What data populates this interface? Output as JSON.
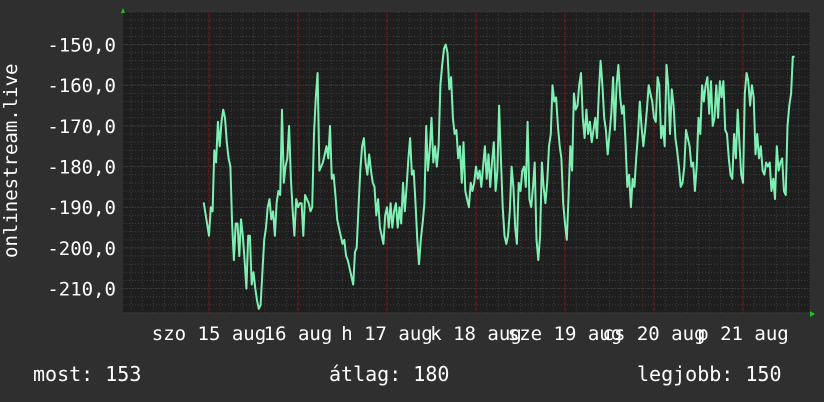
{
  "chart_data": {
    "type": "line",
    "ylabel": "onlinestream.live",
    "y_ticks": [
      "-150,0",
      "-160,0",
      "-170,0",
      "-180,0",
      "-190,0",
      "-200,0",
      "-210,0"
    ],
    "x_tick_labels": [
      "szo 15 aug",
      "16 aug",
      "h 17 aug",
      "k 18 aug",
      "sze 19 aug",
      "cs 20 aug",
      "p 21 aug"
    ],
    "ylim": [
      -216,
      -142
    ],
    "x_range_days": [
      0,
      7
    ],
    "grid": true,
    "series": [
      {
        "color": "#7ef0b4",
        "x_days": [
          -0.06,
          0.0,
          0.02,
          0.04,
          0.06,
          0.08,
          0.1,
          0.12,
          0.14,
          0.16,
          0.18,
          0.2,
          0.22,
          0.24,
          0.26,
          0.28,
          0.3,
          0.32,
          0.34,
          0.36,
          0.38,
          0.4,
          0.42,
          0.44,
          0.46,
          0.48,
          0.5,
          0.52,
          0.54,
          0.56,
          0.58,
          0.6,
          0.62,
          0.64,
          0.66,
          0.68,
          0.7,
          0.72,
          0.74,
          0.76,
          0.78,
          0.8,
          0.82,
          0.84,
          0.86,
          0.88,
          0.9,
          0.92,
          0.94,
          0.96,
          0.98,
          1.0,
          1.02,
          1.04,
          1.06,
          1.08,
          1.1,
          1.12,
          1.14,
          1.16,
          1.18,
          1.2,
          1.22,
          1.24,
          1.26,
          1.28,
          1.3,
          1.32,
          1.34,
          1.36,
          1.38,
          1.4,
          1.42,
          1.44,
          1.46,
          1.48,
          1.5,
          1.52,
          1.54,
          1.56,
          1.58,
          1.6,
          1.62,
          1.64,
          1.66,
          1.68,
          1.7,
          1.72,
          1.74,
          1.76,
          1.78,
          1.8,
          1.82,
          1.84,
          1.86,
          1.88,
          1.9,
          1.92,
          1.94,
          1.96,
          1.98,
          2.0,
          2.02,
          2.04,
          2.06,
          2.08,
          2.1,
          2.12,
          2.14,
          2.16,
          2.18,
          2.2,
          2.22,
          2.24,
          2.26,
          2.28,
          2.3,
          2.32,
          2.34,
          2.36,
          2.38,
          2.4,
          2.42,
          2.44,
          2.46,
          2.48,
          2.5,
          2.52,
          2.54,
          2.56,
          2.58,
          2.6,
          2.62,
          2.64,
          2.66,
          2.68,
          2.7,
          2.72,
          2.74,
          2.76,
          2.78,
          2.8,
          2.82,
          2.84,
          2.86,
          2.88,
          2.9,
          2.92,
          2.94,
          2.96,
          2.98,
          3.0,
          3.02,
          3.04,
          3.06,
          3.08,
          3.1,
          3.12,
          3.14,
          3.16,
          3.18,
          3.2,
          3.22,
          3.24,
          3.26,
          3.28,
          3.3,
          3.32,
          3.34,
          3.36,
          3.38,
          3.4,
          3.42,
          3.44,
          3.46,
          3.48,
          3.5,
          3.52,
          3.54,
          3.56,
          3.58,
          3.6,
          3.62,
          3.64,
          3.66,
          3.68,
          3.7,
          3.72,
          3.74,
          3.76,
          3.78,
          3.8,
          3.82,
          3.84,
          3.86,
          3.88,
          3.9,
          3.92,
          3.94,
          3.96,
          3.98,
          4.0,
          4.02,
          4.04,
          4.06,
          4.08,
          4.1,
          4.12,
          4.14,
          4.16,
          4.18,
          4.2,
          4.22,
          4.24,
          4.26,
          4.28,
          4.3,
          4.32,
          4.34,
          4.36,
          4.38,
          4.4,
          4.42,
          4.44,
          4.46,
          4.48,
          4.5,
          4.52,
          4.54,
          4.56,
          4.58,
          4.6,
          4.62,
          4.64,
          4.66,
          4.68,
          4.7,
          4.72,
          4.74,
          4.76,
          4.78,
          4.8,
          4.82,
          4.84,
          4.86,
          4.88,
          4.9,
          4.92,
          4.94,
          4.96,
          4.98,
          5.0,
          5.02,
          5.04,
          5.06,
          5.08,
          5.1,
          5.12,
          5.14,
          5.16,
          5.18,
          5.2,
          5.22,
          5.24,
          5.26,
          5.28,
          5.3,
          5.32,
          5.34,
          5.36,
          5.38,
          5.4,
          5.42,
          5.44,
          5.46,
          5.48,
          5.5,
          5.52,
          5.54,
          5.56,
          5.58,
          5.6,
          5.62,
          5.64,
          5.66,
          5.68,
          5.7,
          5.72,
          5.74,
          5.76,
          5.78,
          5.8,
          5.82,
          5.84,
          5.86,
          5.88,
          5.9,
          5.92,
          5.94,
          5.96,
          5.98,
          6.0,
          6.02,
          6.04,
          6.06,
          6.08,
          6.1,
          6.12,
          6.14,
          6.16,
          6.18,
          6.2,
          6.22,
          6.24,
          6.26,
          6.28,
          6.3,
          6.32,
          6.34,
          6.36,
          6.38,
          6.4,
          6.42,
          6.44,
          6.46,
          6.48,
          6.5,
          6.52,
          6.54,
          6.56,
          6.58,
          6.6,
          6.62,
          6.64,
          6.66,
          6.68,
          6.7,
          6.72,
          6.74,
          6.76,
          6.78,
          6.8,
          6.82,
          6.84,
          6.86,
          6.88,
          6.9,
          6.92,
          6.94,
          6.96,
          6.98,
          7.0,
          7.02,
          7.04,
          7.06,
          7.08,
          7.1,
          7.12,
          7.14,
          7.16,
          7.18,
          7.2,
          7.22,
          7.24,
          7.26,
          7.28,
          7.3,
          7.32,
          7.34,
          7.36,
          7.38,
          7.4,
          7.42
        ],
        "values": [
          -188.8,
          -197.0,
          -190.0,
          -191.0,
          -176.0,
          -179.0,
          -169.0,
          -175.0,
          -169.0,
          -166.0,
          -168.0,
          -174.0,
          -178.0,
          -180.0,
          -194.0,
          -203.0,
          -194.0,
          -194.0,
          -202.0,
          -193.0,
          -197.0,
          -203.0,
          -210.0,
          -197.0,
          -197.0,
          -209.0,
          -206.0,
          -210.0,
          -213.0,
          -215.0,
          -214.0,
          -206.0,
          -198.0,
          -195.0,
          -190.0,
          -188.0,
          -193.0,
          -191.0,
          -197.0,
          -189.0,
          -186.0,
          -187.0,
          -166.0,
          -184.0,
          -180.0,
          -178.0,
          -170.0,
          -183.0,
          -191.0,
          -197.0,
          -188.0,
          -190.0,
          -189.0,
          -189.0,
          -197.0,
          -187.0,
          -188.0,
          -189.0,
          -191.0,
          -190.0,
          -172.0,
          -163.0,
          -157.0,
          -181.0,
          -180.0,
          -179.0,
          -177.0,
          -175.0,
          -178.0,
          -170.0,
          -183.0,
          -182.0,
          -187.0,
          -193.0,
          -195.0,
          -197.0,
          -199.0,
          -198.0,
          -202.0,
          -203.0,
          -205.0,
          -207.0,
          -209.0,
          -201.0,
          -200.0,
          -190.0,
          -181.0,
          -175.0,
          -173.0,
          -179.0,
          -182.0,
          -177.0,
          -181.0,
          -184.0,
          -185.0,
          -192.0,
          -188.0,
          -195.0,
          -197.0,
          -199.0,
          -192.0,
          -190.0,
          -195.0,
          -189.0,
          -195.0,
          -191.0,
          -189.0,
          -195.0,
          -190.0,
          -194.0,
          -184.0,
          -191.0,
          -185.0,
          -178.0,
          -173.0,
          -182.0,
          -181.0,
          -189.0,
          -198.0,
          -204.0,
          -198.0,
          -194.0,
          -189.0,
          -170.0,
          -181.0,
          -176.0,
          -168.0,
          -179.0,
          -175.0,
          -180.0,
          -175.0,
          -160.0,
          -155.0,
          -151.0,
          -150.0,
          -152.0,
          -161.0,
          -158.0,
          -168.0,
          -172.0,
          -171.0,
          -178.0,
          -175.0,
          -184.0,
          -174.0,
          -186.0,
          -188.0,
          -190.0,
          -184.0,
          -186.0,
          -184.0,
          -180.0,
          -183.0,
          -181.0,
          -185.0,
          -180.0,
          -175.0,
          -183.0,
          -177.0,
          -185.0,
          -179.0,
          -174.0,
          -186.0,
          -181.0,
          -165.0,
          -178.0,
          -190.0,
          -197.0,
          -199.0,
          -197.0,
          -191.0,
          -180.0,
          -185.0,
          -195.0,
          -199.0,
          -184.0,
          -186.0,
          -181.0,
          -180.0,
          -185.0,
          -169.0,
          -188.0,
          -190.0,
          -185.0,
          -179.0,
          -198.0,
          -203.0,
          -197.0,
          -179.0,
          -185.0,
          -189.0,
          -184.0,
          -175.0,
          -172.0,
          -160.0,
          -164.0,
          -163.0,
          -170.0,
          -175.0,
          -178.0,
          -189.0,
          -194.0,
          -198.0,
          -187.0,
          -175.0,
          -181.0,
          -162.0,
          -166.0,
          -165.0,
          -160.0,
          -157.0,
          -168.0,
          -173.0,
          -166.0,
          -172.0,
          -169.0,
          -174.0,
          -171.0,
          -168.0,
          -173.0,
          -162.0,
          -154.0,
          -160.0,
          -168.0,
          -171.0,
          -177.0,
          -172.0,
          -167.0,
          -158.0,
          -171.0,
          -160.0,
          -155.0,
          -163.0,
          -167.0,
          -165.0,
          -174.0,
          -185.0,
          -182.0,
          -190.0,
          -183.0,
          -185.0,
          -178.0,
          -172.0,
          -164.0,
          -170.0,
          -175.0,
          -171.0,
          -166.0,
          -160.0,
          -162.0,
          -164.0,
          -168.0,
          -169.0,
          -158.0,
          -160.0,
          -173.0,
          -170.0,
          -175.0,
          -155.0,
          -160.0,
          -172.0,
          -161.0,
          -165.0,
          -173.0,
          -176.0,
          -180.0,
          -185.0,
          -184.0,
          -180.0,
          -171.0,
          -173.0,
          -175.0,
          -180.0,
          -179.0,
          -186.0,
          -180.0,
          -168.0,
          -172.0,
          -160.0,
          -164.0,
          -160.0,
          -158.0,
          -167.0,
          -159.0,
          -170.0,
          -168.0,
          -160.0,
          -168.0,
          -159.0,
          -163.0,
          -159.0,
          -171.0,
          -172.0,
          -178.0,
          -182.0,
          -183.0,
          -172.0,
          -178.0,
          -166.0,
          -174.0,
          -182.0,
          -184.0,
          -162.0,
          -157.0,
          -159.0,
          -165.0,
          -160.0,
          -163.0,
          -177.0,
          -172.0,
          -178.0,
          -175.0,
          -181.0,
          -182.0,
          -179.0,
          -180.0,
          -179.0,
          -186.0,
          -183.0,
          -188.0,
          -175.0,
          -181.0,
          -179.0,
          -178.0,
          -186.0,
          -187.0,
          -170.0,
          -165.0,
          -162.0,
          -153.0,
          -153.0
        ]
      }
    ]
  },
  "stats": {
    "current": "most: 153",
    "average": "átlag: 180",
    "best": "legjobb: 150"
  }
}
